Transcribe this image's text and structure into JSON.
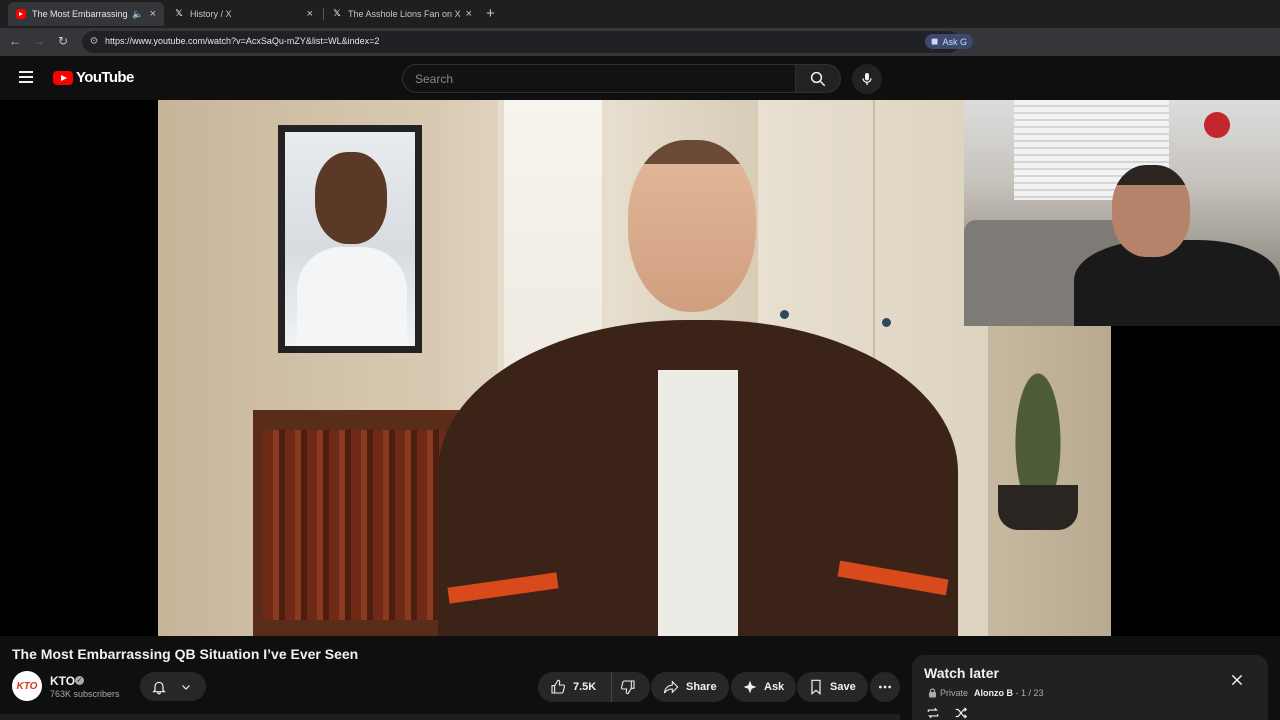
{
  "browser": {
    "tabs": [
      {
        "title": "The Most Embarrassing QB",
        "active": true,
        "icon": "youtube-icon"
      },
      {
        "title": "History / X",
        "active": false,
        "icon": "x-icon"
      },
      {
        "title": "The Asshole Lions Fan on X: \"ht",
        "active": false,
        "icon": "x-icon"
      }
    ],
    "url": "https://www.youtube.com/watch?v=AcxSaQu-mZY&list=WL&index=2",
    "ask_label": "Ask G"
  },
  "masthead": {
    "logo_text": "YouTube",
    "search_placeholder": "Search"
  },
  "video": {
    "title": "The Most Embarrassing QB Situation I’ve Ever Seen",
    "channel": {
      "name": "KTO",
      "avatar_text": "KTO",
      "subscribers": "763K subscribers",
      "verified": true
    },
    "actions": {
      "likes": "7.5K",
      "share": "Share",
      "ask": "Ask",
      "save": "Save"
    }
  },
  "watch_later": {
    "title": "Watch later",
    "privacy": "Private",
    "owner": "Alonzo B",
    "position": "1 / 23"
  },
  "colors": {
    "brand_red": "#ff0000",
    "background": "#0f0f0f",
    "pill": "#272727",
    "panel": "#212121"
  }
}
